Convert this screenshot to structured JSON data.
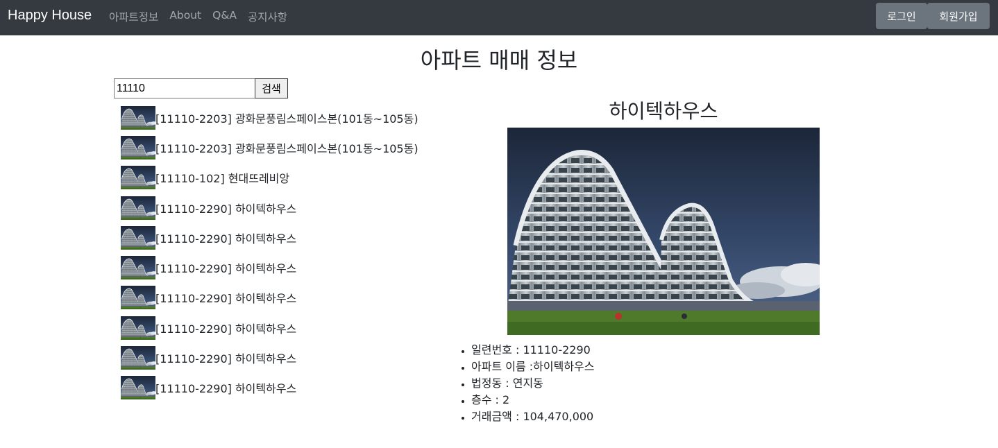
{
  "navbar": {
    "brand": "Happy House",
    "links": [
      "아파트정보",
      "About",
      "Q&A",
      "공지사항"
    ],
    "login_label": "로그인",
    "signup_label": "회원가입"
  },
  "page": {
    "title": "아파트 매매 정보"
  },
  "search": {
    "value": "11110",
    "button_label": "검색"
  },
  "apartments": [
    "[11110-2203] 광화문풍림스페이스본(101동~105동)",
    "[11110-2203] 광화문풍림스페이스본(101동~105동)",
    "[11110-102] 현대뜨레비앙",
    "[11110-2290] 하이텍하우스",
    "[11110-2290] 하이텍하우스",
    "[11110-2290] 하이텍하우스",
    "[11110-2290] 하이텍하우스",
    "[11110-2290] 하이텍하우스",
    "[11110-2290] 하이텍하우스",
    "[11110-2290] 하이텍하우스"
  ],
  "detail": {
    "title": "하이텍하우스",
    "info": [
      "일련번호 : 11110-2290",
      "아파트 이름 :하이텍하우스",
      "법정동 : 연지동",
      "층수 : 2",
      "거래금액 : 104,470,000"
    ]
  },
  "colors": {
    "navbar": "#343a40",
    "button": "#6c757d",
    "text": "#212529"
  },
  "icons": {
    "apartment_image": "apartment-building-photo"
  }
}
